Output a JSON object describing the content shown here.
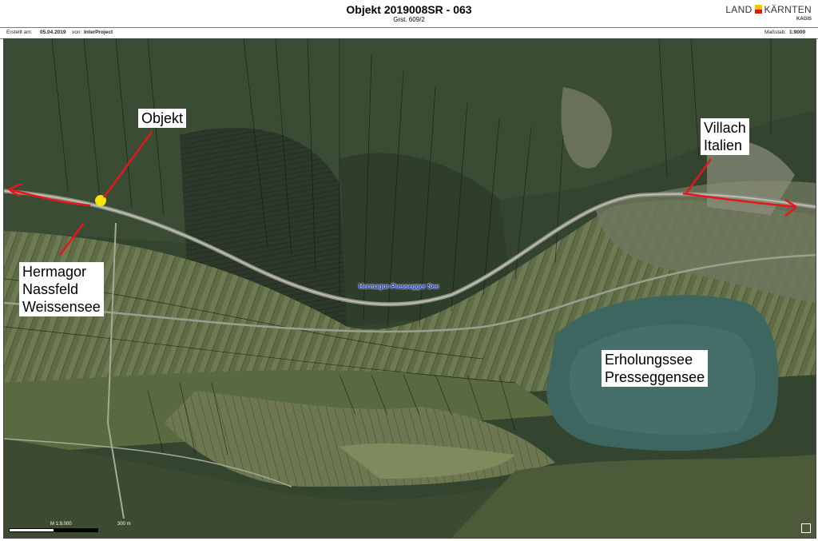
{
  "header": {
    "title": "Objekt 2019008SR - 063",
    "subtitle": "Grst. 609/2",
    "logo_text_left": "LAND",
    "logo_text_right": "KÄRNTEN",
    "logo_sub": "KAGIS"
  },
  "meta": {
    "created_label": "Erstellt am:",
    "created_date": "05.04.2019",
    "from_label": "von:",
    "from_value": "InterProject",
    "scale_label": "Maßstab:",
    "scale_value": "1:9000"
  },
  "map": {
    "labels": {
      "objekt": "Objekt",
      "villach": "Villach\nItalien",
      "hermagor": "Hermagor\nNassfeld\nWeissensee",
      "erholungssee": "Erholungssee\nPresseggensee"
    },
    "place_label": "Hermagor-Pressegger See",
    "scale_text_left": "M 1:9,000",
    "scale_text_right": "300 m"
  },
  "colors": {
    "arrow": "#e8151c",
    "highlight": "#f5e60a",
    "lake": "#3d6660",
    "forest": "#2c3a2a",
    "meadow": "#5d6a44",
    "place_label": "#1a37c9"
  }
}
